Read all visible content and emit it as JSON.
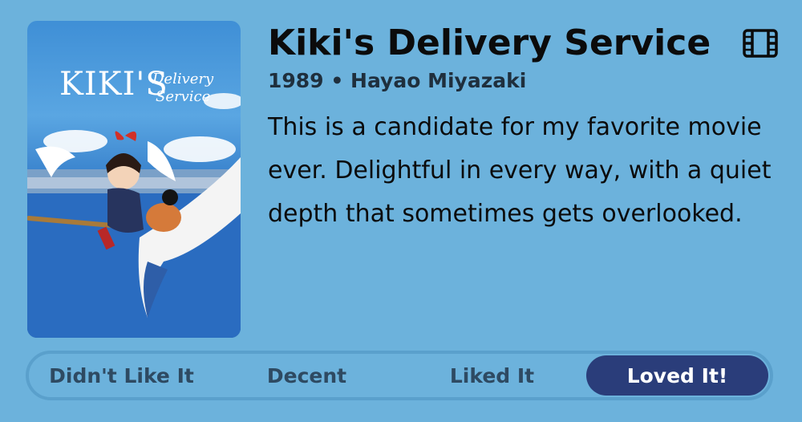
{
  "movie": {
    "title": "Kiki's Delivery Service",
    "year": "1989",
    "separator": "•",
    "director": "Hayao Miyazaki",
    "review": "This is a candidate for my favorite movie ever. Delightful in every way, with a quiet depth that sometimes gets overlooked.",
    "poster_title": "KIKI'S",
    "poster_subtitle_1": "Delivery",
    "poster_subtitle_2": "Service",
    "type_icon": "film-icon"
  },
  "rating": {
    "options": [
      "Didn't Like It",
      "Decent",
      "Liked It",
      "Loved It!"
    ],
    "selected_index": 3
  },
  "colors": {
    "background": "#6cb2dc",
    "selected": "#2a3d7a"
  }
}
